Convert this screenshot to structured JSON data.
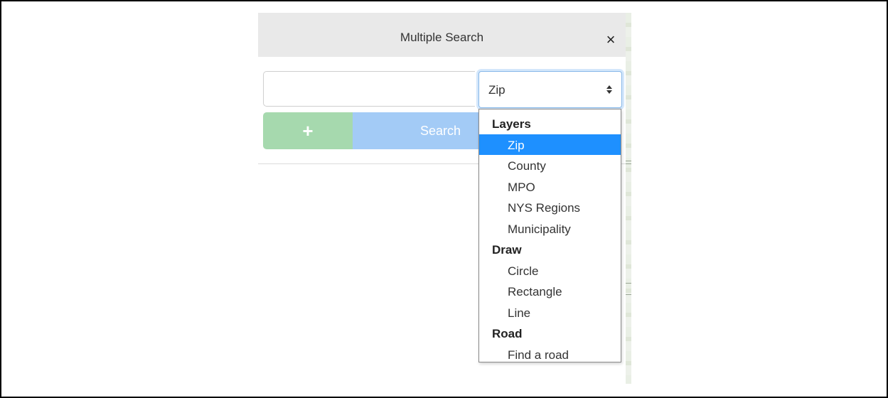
{
  "dialog": {
    "title": "Multiple Search",
    "close_symbol": "×"
  },
  "search_input": {
    "value": "",
    "placeholder": ""
  },
  "layer_select": {
    "selected": "Zip"
  },
  "buttons": {
    "add_symbol": "+",
    "search_label": "Search"
  },
  "dropdown": {
    "groups": [
      {
        "label": "Layers",
        "options": [
          "Zip",
          "County",
          "MPO",
          "NYS Regions",
          "Municipality"
        ]
      },
      {
        "label": "Draw",
        "options": [
          "Circle",
          "Rectangle",
          "Line"
        ]
      },
      {
        "label": "Road",
        "options": [
          "Find a road"
        ]
      }
    ],
    "highlighted": "Zip"
  },
  "colors": {
    "header_bg": "#e9e9e9",
    "add_button": "#a6d9ae",
    "search_button": "#a3cbf6",
    "highlight": "#1e90ff"
  }
}
